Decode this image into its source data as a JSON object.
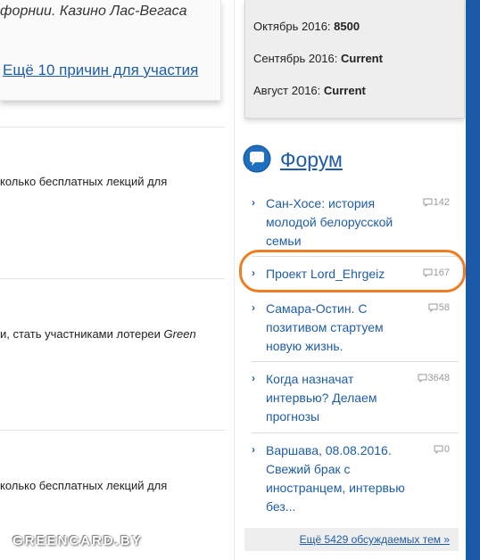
{
  "promo": {
    "text": "форнии. Казино Лас-Вегаса",
    "link": "Ещё 10 причин для участия"
  },
  "articles": [
    {
      "text": "колько бесплатных лекций для"
    },
    {
      "text_before": "и, стать участниками лотереи ",
      "text_italic": "Green"
    },
    {
      "text": "колько бесплатных лекций для"
    }
  ],
  "stats": [
    {
      "label": "Октябрь 2016: ",
      "value": "8500"
    },
    {
      "label": "Сентябрь 2016: ",
      "value": "Current"
    },
    {
      "label": "Август 2016: ",
      "value": "Current"
    }
  ],
  "forum": {
    "title": "Форум",
    "items": [
      {
        "lines": [
          "Сан-Хосе: история",
          "молодой белорусской",
          "семьи"
        ],
        "count": "142"
      },
      {
        "lines": [
          "Проект Lord_Ehrgeiz"
        ],
        "count": "167"
      },
      {
        "lines": [
          "Самара-Остин. С",
          "позитивом стартуем",
          "новую жизнь."
        ],
        "count": "58"
      },
      {
        "lines": [
          "Когда назначат",
          "интервью? Делаем",
          "прогнозы"
        ],
        "count": "3648"
      },
      {
        "lines": [
          "Варшава, 08.08.2016.",
          "Свежий брак с",
          "иностранцем, интервью",
          "без..."
        ],
        "count": "0"
      }
    ],
    "more_link": "Ещё 5429 обсуждаемых тем »"
  },
  "watermark": "GREENCARD.BY",
  "colors": {
    "link": "#1f5ca8",
    "highlight": "#ef7d22",
    "sidebar_bar": "#1a5aa6"
  }
}
